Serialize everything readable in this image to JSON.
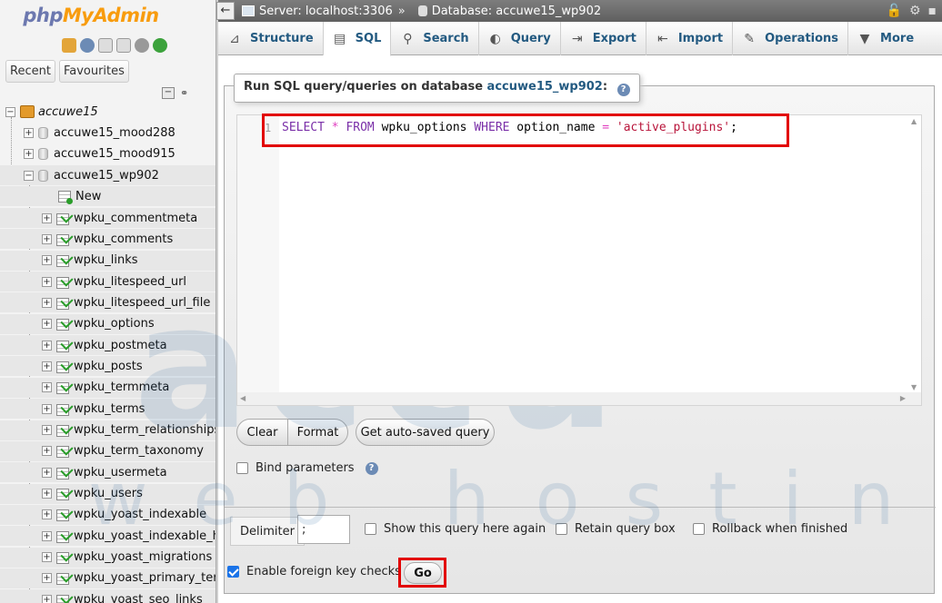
{
  "nav": {
    "logo_part1": "php",
    "logo_part2": "MyAdmin",
    "tabs": [
      "Recent",
      "Favourites"
    ],
    "root": "accuwe15",
    "databases": [
      "accuwe15_mood288",
      "accuwe15_mood915",
      "accuwe15_wp902"
    ],
    "new_label": "New",
    "tables": [
      "wpku_commentmeta",
      "wpku_comments",
      "wpku_links",
      "wpku_litespeed_url",
      "wpku_litespeed_url_file",
      "wpku_options",
      "wpku_postmeta",
      "wpku_posts",
      "wpku_termmeta",
      "wpku_terms",
      "wpku_term_relationships",
      "wpku_term_taxonomy",
      "wpku_usermeta",
      "wpku_users",
      "wpku_yoast_indexable",
      "wpku_yoast_indexable_hierarchy",
      "wpku_yoast_migrations",
      "wpku_yoast_primary_term",
      "wpku_yoast_seo_links"
    ]
  },
  "breadcrumb": {
    "back": "←",
    "server": "Server: localhost:3306",
    "sep": "»",
    "database": "Database: accuwe15_wp902"
  },
  "tabs": [
    "Structure",
    "SQL",
    "Search",
    "Query",
    "Export",
    "Import",
    "Operations",
    "More"
  ],
  "sql": {
    "legend": "Run SQL query/queries on database",
    "legend_db": "accuwe15_wp902",
    "legend_suffix": ":",
    "line_number": "1",
    "tokens": [
      "SELECT",
      " ",
      "*",
      " ",
      "FROM",
      " wpku_options ",
      "WHERE",
      " option_name ",
      "=",
      " ",
      "'active_plugins'",
      ";"
    ],
    "buttons": {
      "clear": "Clear",
      "format": "Format",
      "autosaved": "Get auto-saved query"
    },
    "bind_parameters": "Bind parameters"
  },
  "options": {
    "delimiter_label": "Delimiter",
    "delimiter_value": ";",
    "show_query": "Show this query here again",
    "retain_box": "Retain query box",
    "rollback": "Rollback when finished",
    "foreign_keys": "Enable foreign key checks",
    "go": "Go"
  },
  "watermark": {
    "line1": "accu",
    "line2": "web hosting"
  },
  "colors": {
    "highlight": "#e20000",
    "link": "#235a81",
    "watermark": "#1d5d99"
  }
}
